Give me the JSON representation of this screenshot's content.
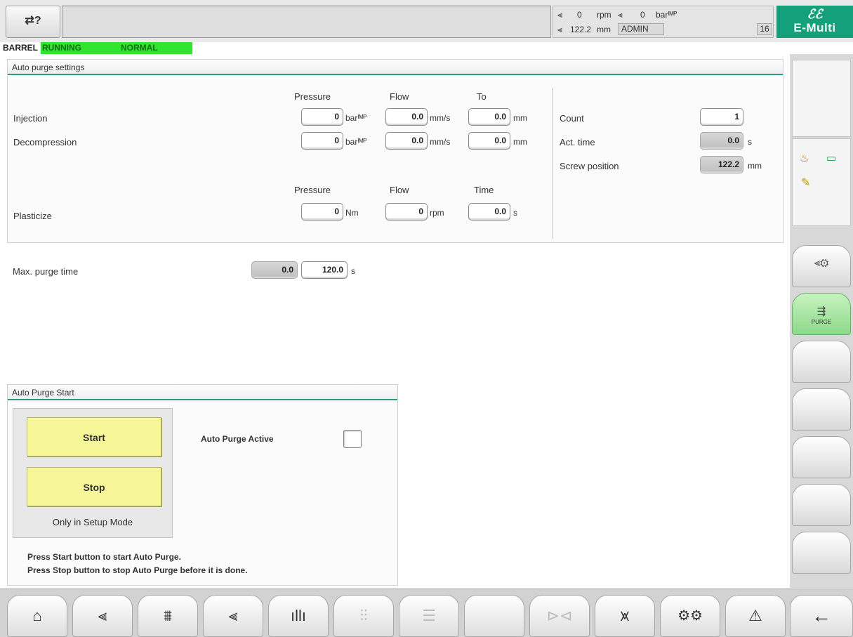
{
  "header": {
    "help_icon": "question-context-icon",
    "help_glyph": "⇄?",
    "message": "",
    "speed_value": "0",
    "speed_unit": "rpm",
    "pressure_value": "0",
    "pressure_unit": "barᴵᴹᴾ",
    "position_value": "122.2",
    "position_unit": "mm",
    "user": "ADMIN",
    "slot": "16",
    "logo_text": "E-Multi",
    "logo_mark": "ℰℰ"
  },
  "status": {
    "area": "BARREL",
    "state": "RUNNING",
    "mode": "NORMAL"
  },
  "auto_purge_settings": {
    "title": "Auto purge settings",
    "col_pressure": "Pressure",
    "col_flow": "Flow",
    "col_to": "To",
    "col_time": "Time",
    "injection": {
      "label": "Injection",
      "pressure": "0",
      "pressure_unit": "barᴵᴹᴾ",
      "flow": "0.0",
      "flow_unit": "mm/s",
      "to": "0.0",
      "to_unit": "mm"
    },
    "decompression": {
      "label": "Decompression",
      "pressure": "0",
      "pressure_unit": "barᴵᴹᴾ",
      "flow": "0.0",
      "flow_unit": "mm/s",
      "to": "0.0",
      "to_unit": "mm"
    },
    "plasticize": {
      "label": "Plasticize",
      "pressure": "0",
      "pressure_unit": "Nm",
      "flow": "0",
      "flow_unit": "rpm",
      "time": "0.0",
      "time_unit": "s"
    },
    "count": {
      "label": "Count",
      "value": "1"
    },
    "act_time": {
      "label": "Act. time",
      "value": "0.0",
      "unit": "s"
    },
    "screw_position": {
      "label": "Screw position",
      "value": "122.2",
      "unit": "mm"
    }
  },
  "max_purge_time": {
    "label": "Max. purge time",
    "actual": "0.0",
    "setpoint": "120.0",
    "unit": "s"
  },
  "auto_purge_start": {
    "title": "Auto Purge Start",
    "start_label": "Start",
    "stop_label": "Stop",
    "setup_note": "Only in Setup Mode",
    "active_label": "Auto Purge Active",
    "active_checked": false,
    "help_line_1": "Press Start button to start Auto Purge.",
    "help_line_2": "Press Stop button to stop Auto Purge before it is done."
  },
  "sidebar": {
    "buttons": [
      {
        "icon": "injection-unit-icon",
        "glyph": "⫷⚙",
        "label": ""
      },
      {
        "icon": "purge-icon",
        "glyph": "⇶",
        "label": "PURGE",
        "active": true
      },
      {
        "icon": "",
        "glyph": "",
        "label": ""
      },
      {
        "icon": "",
        "glyph": "",
        "label": ""
      },
      {
        "icon": "",
        "glyph": "",
        "label": ""
      },
      {
        "icon": "",
        "glyph": "",
        "label": ""
      },
      {
        "icon": "",
        "glyph": "",
        "label": ""
      }
    ],
    "cell_icons": [
      "heater-icon",
      "barrel-icon",
      "wrench-icon"
    ]
  },
  "bottom_nav": [
    {
      "icon": "home-icon",
      "glyph": "⌂",
      "enabled": true
    },
    {
      "icon": "injection-icon",
      "glyph": "⫷",
      "enabled": true
    },
    {
      "icon": "barrel-temp-icon",
      "glyph": "⩩",
      "enabled": true
    },
    {
      "icon": "injection-setup-icon",
      "glyph": "⫷",
      "enabled": true
    },
    {
      "icon": "temperature-icon",
      "glyph": "ıllı",
      "enabled": true
    },
    {
      "icon": "profile-icon",
      "glyph": "⫶⫶",
      "enabled": false
    },
    {
      "icon": "list-icon",
      "glyph": "☰",
      "enabled": false
    },
    {
      "icon": "blank-icon",
      "glyph": "",
      "enabled": false
    },
    {
      "icon": "valve-icon",
      "glyph": "⊳⊲",
      "enabled": false
    },
    {
      "icon": "chart-icon",
      "glyph": "⩙",
      "enabled": true
    },
    {
      "icon": "settings-icon",
      "glyph": "⚙⚙",
      "enabled": true
    },
    {
      "icon": "warning-icon",
      "glyph": "⚠",
      "enabled": true
    },
    {
      "icon": "back-arrow-icon",
      "glyph": "←",
      "enabled": true
    }
  ]
}
